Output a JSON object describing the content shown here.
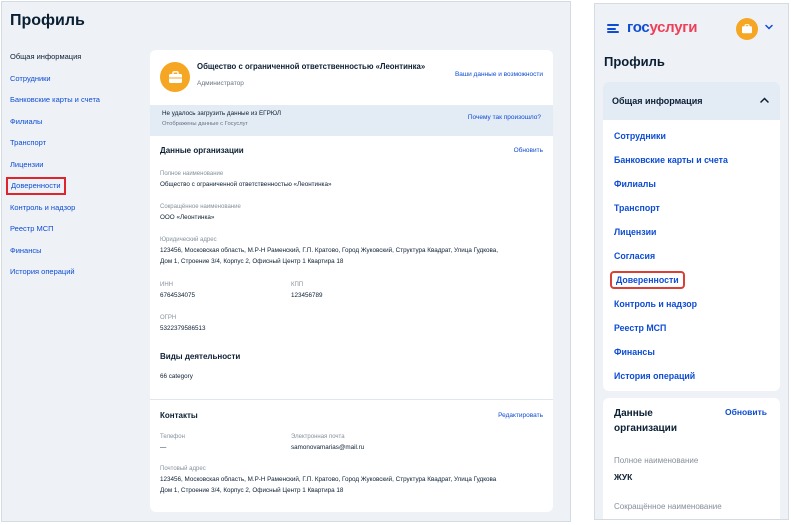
{
  "desktop": {
    "title": "Профиль",
    "sidebar": [
      {
        "label": "Общая информация",
        "active": true
      },
      {
        "label": "Сотрудники"
      },
      {
        "label": "Банковские карты и счета"
      },
      {
        "label": "Филиалы"
      },
      {
        "label": "Транспорт"
      },
      {
        "label": "Лицензии"
      },
      {
        "label": "Доверенности",
        "highlighted": true
      },
      {
        "label": "Контроль и надзор"
      },
      {
        "label": "Реестр МСП"
      },
      {
        "label": "Финансы"
      },
      {
        "label": "История операций"
      }
    ],
    "org": {
      "name": "Общество с ограниченной ответственностью «Леонтинка»",
      "role": "Администратор",
      "link": "Ваши данные и возможности",
      "logo_icon": "briefcase-icon"
    },
    "warning": {
      "line1": "Не удалось загрузить данные из ЕГРЮЛ",
      "line2": "Отображены данные с Госуслуг",
      "link": "Почему так произошло?"
    },
    "org_data": {
      "title": "Данные организации",
      "refresh": "Обновить",
      "full_name_label": "Полное наименование",
      "full_name": "Общество с ограниченной ответственностью «Леонтинка»",
      "short_name_label": "Сокращённое наименование",
      "short_name": "ООО «Леонтинка»",
      "address_label": "Юридический адрес",
      "address_line1": "123456, Московская область, М.Р-Н Раменский, Г.П. Кратово, Город Жуковский, Структура Квадрат, Улица Гудкова,",
      "address_line2": "Дом 1, Строение 3/4, Корпус 2, Офисный Центр 1 Квартира 18",
      "inn_label": "ИНН",
      "inn": "6764534075",
      "kpp_label": "КПП",
      "kpp": "123456789",
      "ogrn_label": "ОГРН",
      "ogrn": "5322379586513",
      "activities_title": "Виды деятельности",
      "activities_value": "66 category"
    },
    "contacts": {
      "title": "Контакты",
      "edit": "Редактировать",
      "phone_label": "Телефон",
      "phone": "—",
      "email_label": "Электронная почта",
      "email": "samonovamarias@mail.ru",
      "postal_label": "Почтовый адрес",
      "postal_line1": "123456, Московская область, М.Р-Н Раменский, Г.П. Кратово, Город Жуковский, Структура Квадрат, Улица Гудкова",
      "postal_line2": "Дом 1, Строение 3/4, Корпус 2, Офисный Центр 1 Квартира 18"
    }
  },
  "mobile": {
    "brand_part1": "гос",
    "brand_part2": "услуги",
    "title": "Профиль",
    "menu_header": "Общая информация",
    "menu": [
      {
        "label": "Сотрудники"
      },
      {
        "label": "Банковские карты и счета"
      },
      {
        "label": "Филиалы"
      },
      {
        "label": "Транспорт"
      },
      {
        "label": "Лицензии"
      },
      {
        "label": "Согласия"
      },
      {
        "label": "Доверенности",
        "highlighted": true
      },
      {
        "label": "Контроль и надзор"
      },
      {
        "label": "Реестр МСП"
      },
      {
        "label": "Финансы"
      },
      {
        "label": "История операций"
      }
    ],
    "data_card": {
      "title": "Данные организации",
      "refresh": "Обновить",
      "full_name_label": "Полное наименование",
      "full_name": "ЖУК",
      "short_name_label": "Сокращённое наименование"
    }
  },
  "colors": {
    "link": "#0d4cd3",
    "highlight": "#e0242b",
    "brand_red": "#ee3f58",
    "accent_orange": "#f5a623",
    "panel_bg": "#eef2f7",
    "warning_bg": "#e3ebf5"
  }
}
